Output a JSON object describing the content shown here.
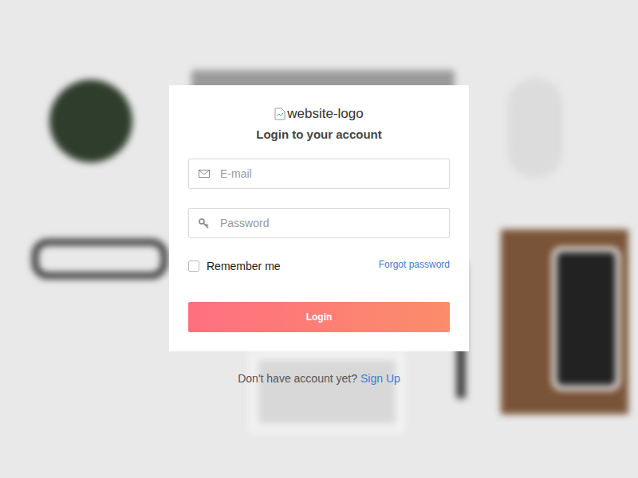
{
  "logo": {
    "alt": "website-logo"
  },
  "title": "Login to your account",
  "fields": [
    {
      "placeholder": "E-mail",
      "kind": "email"
    },
    {
      "placeholder": "Password",
      "kind": "password"
    }
  ],
  "remember": {
    "label": "Remember me",
    "checked": false
  },
  "forgot": "Forgot password",
  "button": "Login",
  "footer": {
    "text": "Don't have account yet?",
    "link": "Sign Up"
  }
}
